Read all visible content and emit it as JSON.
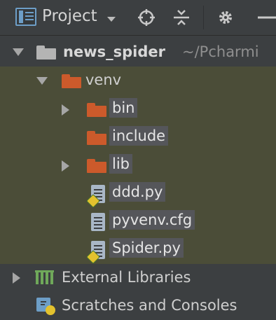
{
  "toolbar": {
    "view_label": "Project",
    "icons": [
      "project-view-icon",
      "locate-icon",
      "collapse-icon",
      "gear-icon",
      "hide-icon"
    ]
  },
  "tree": {
    "root": {
      "label": "news_spider",
      "path_hint": "~/Pcharmi"
    },
    "venv": {
      "label": "venv"
    },
    "bin": {
      "label": "bin"
    },
    "include": {
      "label": "include"
    },
    "lib": {
      "label": "lib"
    },
    "file1": {
      "label": "ddd.py"
    },
    "file2": {
      "label": "pyvenv.cfg"
    },
    "file3": {
      "label": "Spider.py"
    },
    "external_libraries": {
      "label": "External Libraries"
    },
    "scratches": {
      "label": "Scratches and Consoles"
    }
  },
  "colors": {
    "background": "#3c3f41",
    "selection": "#4b4d38",
    "excluded_folder": "#cc5a2b",
    "root_folder": "#b4b4b4",
    "label_highlight": "#55565a"
  }
}
